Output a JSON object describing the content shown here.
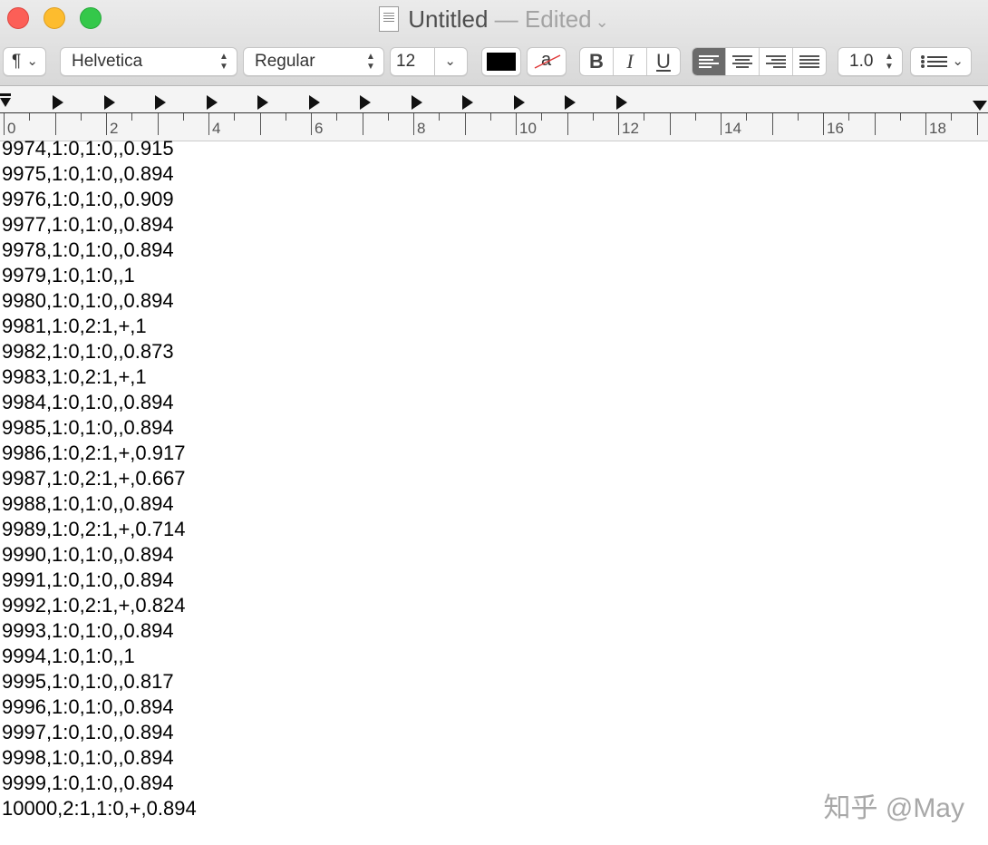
{
  "window": {
    "title": "Untitled",
    "edited": "— Edited"
  },
  "toolbar": {
    "paragraph_icon": "¶",
    "font_family": "Helvetica",
    "font_style": "Regular",
    "font_size": "12",
    "line_spacing": "1.0",
    "bold": "B",
    "italic": "I",
    "underline": "U",
    "text_color": "#000000",
    "highlight_letter": "a"
  },
  "ruler": {
    "labels": [
      "0",
      "2",
      "4",
      "6",
      "8",
      "10",
      "12",
      "14",
      "16",
      "18"
    ]
  },
  "document": {
    "lines": [
      "9974,1:0,1:0,,0.915",
      "9975,1:0,1:0,,0.894",
      "9976,1:0,1:0,,0.909",
      "9977,1:0,1:0,,0.894",
      "9978,1:0,1:0,,0.894",
      "9979,1:0,1:0,,1",
      "9980,1:0,1:0,,0.894",
      "9981,1:0,2:1,+,1",
      "9982,1:0,1:0,,0.873",
      "9983,1:0,2:1,+,1",
      "9984,1:0,1:0,,0.894",
      "9985,1:0,1:0,,0.894",
      "9986,1:0,2:1,+,0.917",
      "9987,1:0,2:1,+,0.667",
      "9988,1:0,1:0,,0.894",
      "9989,1:0,2:1,+,0.714",
      "9990,1:0,1:0,,0.894",
      "9991,1:0,1:0,,0.894",
      "9992,1:0,2:1,+,0.824",
      "9993,1:0,1:0,,0.894",
      "9994,1:0,1:0,,1",
      "9995,1:0,1:0,,0.817",
      "9996,1:0,1:0,,0.894",
      "9997,1:0,1:0,,0.894",
      "9998,1:0,1:0,,0.894",
      "9999,1:0,1:0,,0.894",
      "10000,2:1,1:0,+,0.894"
    ]
  },
  "watermark": "知乎 @May"
}
